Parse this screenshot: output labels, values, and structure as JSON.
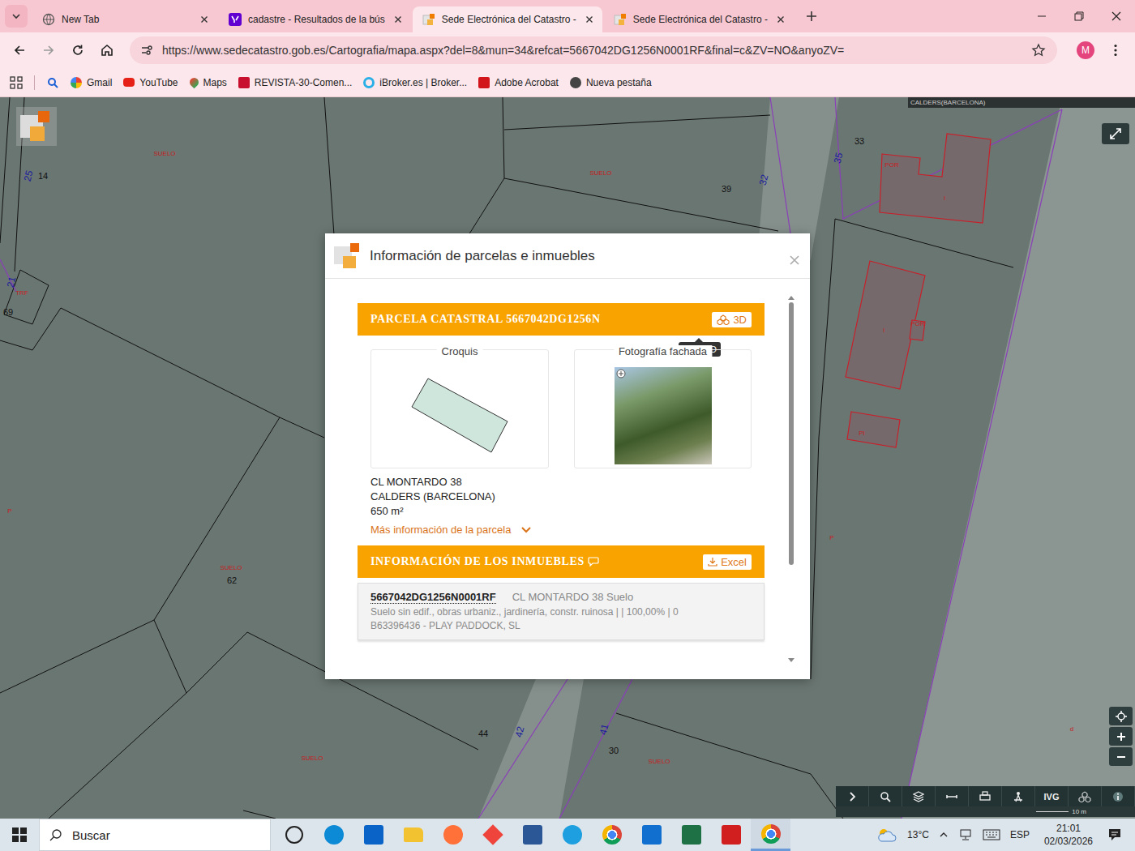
{
  "browser": {
    "tabs": [
      {
        "label": "New Tab",
        "kind": "globe",
        "selected": false
      },
      {
        "label": "cadastre - Resultados de la bús",
        "kind": "yahoo",
        "selected": false
      },
      {
        "label": "Sede Electrónica del Catastro -",
        "kind": "catastro",
        "selected": true
      },
      {
        "label": "Sede Electrónica del Catastro -",
        "kind": "catastro",
        "selected": false
      }
    ],
    "address": "https://www.sedecatastro.gob.es/Cartografia/mapa.aspx?del=8&mun=34&refcat=5667042DG1256N0001RF&final=c&ZV=NO&anyoZV=",
    "profile": "M",
    "bookmarks": [
      {
        "label": "Gmail",
        "kind": "google"
      },
      {
        "label": "YouTube",
        "kind": "youtube"
      },
      {
        "label": "Maps",
        "kind": "maps"
      },
      {
        "label": "REVISTA-30-Comen...",
        "kind": "revista"
      },
      {
        "label": "iBroker.es | Broker...",
        "kind": "ibroker"
      },
      {
        "label": "Adobe Acrobat",
        "kind": "acrobat"
      },
      {
        "label": "Nueva pestaña",
        "kind": "page"
      }
    ]
  },
  "map": {
    "region": "CALDERS(BARCELONA)",
    "labels": [
      {
        "text": "SUELO",
        "kind": "landuse"
      },
      {
        "text": "14",
        "kind": "number"
      },
      {
        "text": "25",
        "kind": "street"
      },
      {
        "text": "SUELO",
        "kind": "landuse"
      },
      {
        "text": "39",
        "kind": "number"
      },
      {
        "text": "32",
        "kind": "street"
      },
      {
        "text": "35",
        "kind": "street"
      },
      {
        "text": "33",
        "kind": "number"
      },
      {
        "text": "POR",
        "kind": "building"
      },
      {
        "text": "I",
        "kind": "building"
      },
      {
        "text": "21",
        "kind": "street"
      },
      {
        "text": "TRF",
        "kind": "building"
      },
      {
        "text": "69",
        "kind": "number"
      },
      {
        "text": "I",
        "kind": "building"
      },
      {
        "text": "POR",
        "kind": "building"
      },
      {
        "text": "PI",
        "kind": "building"
      },
      {
        "text": "P",
        "kind": "building"
      },
      {
        "text": "P",
        "kind": "building"
      },
      {
        "text": "SUELO",
        "kind": "landuse"
      },
      {
        "text": "62",
        "kind": "number"
      },
      {
        "text": "44",
        "kind": "number"
      },
      {
        "text": "42",
        "kind": "street"
      },
      {
        "text": "41",
        "kind": "street"
      },
      {
        "text": "30",
        "kind": "number"
      },
      {
        "text": "SUELO",
        "kind": "landuse"
      },
      {
        "text": "SUELO",
        "kind": "landuse"
      },
      {
        "text": "d",
        "kind": "building"
      }
    ],
    "tool_text": "IVG",
    "scale": "10 m"
  },
  "dialog": {
    "title": "Información de parcelas e inmuebles",
    "parcel": {
      "heading": "PARCELA CATASTRAL 5667042DG1256N",
      "button": "3D",
      "tooltip": "Visor 3D",
      "sketch_title": "Croquis",
      "photo_title": "Fotografía fachada",
      "address": [
        "CL MONTARDO 38",
        "CALDERS (BARCELONA)",
        "650 m²"
      ],
      "more": "Más información de la parcela"
    },
    "properties": {
      "heading": "INFORMACIÓN DE LOS INMUEBLES",
      "button": "Excel",
      "rows": [
        {
          "ref": "5667042DG1256N0001RF",
          "address": "CL MONTARDO 38 Suelo",
          "details": "Suelo sin edif., obras urbaniz., jardinería, constr. ruinosa | | 100,00% | 0",
          "owner": "B63396436 - PLAY PADDOCK, SL"
        }
      ]
    }
  },
  "taskbar": {
    "search": "Buscar",
    "apps": [
      {
        "kind": "taskview",
        "active": false
      },
      {
        "kind": "edge",
        "active": false
      },
      {
        "kind": "outlook",
        "active": false
      },
      {
        "kind": "explorer",
        "active": false
      },
      {
        "kind": "firefox",
        "active": false
      },
      {
        "kind": "anydesk",
        "active": false
      },
      {
        "kind": "word",
        "active": false
      },
      {
        "kind": "ie",
        "active": false
      },
      {
        "kind": "chrome",
        "active": false
      },
      {
        "kind": "store",
        "active": false
      },
      {
        "kind": "excel",
        "active": false
      },
      {
        "kind": "acrobat",
        "active": false
      },
      {
        "kind": "chrome-profile",
        "active": true
      }
    ],
    "weather": "13°C",
    "language": "ESP",
    "time": "21:01",
    "date": "02/03/2026"
  }
}
